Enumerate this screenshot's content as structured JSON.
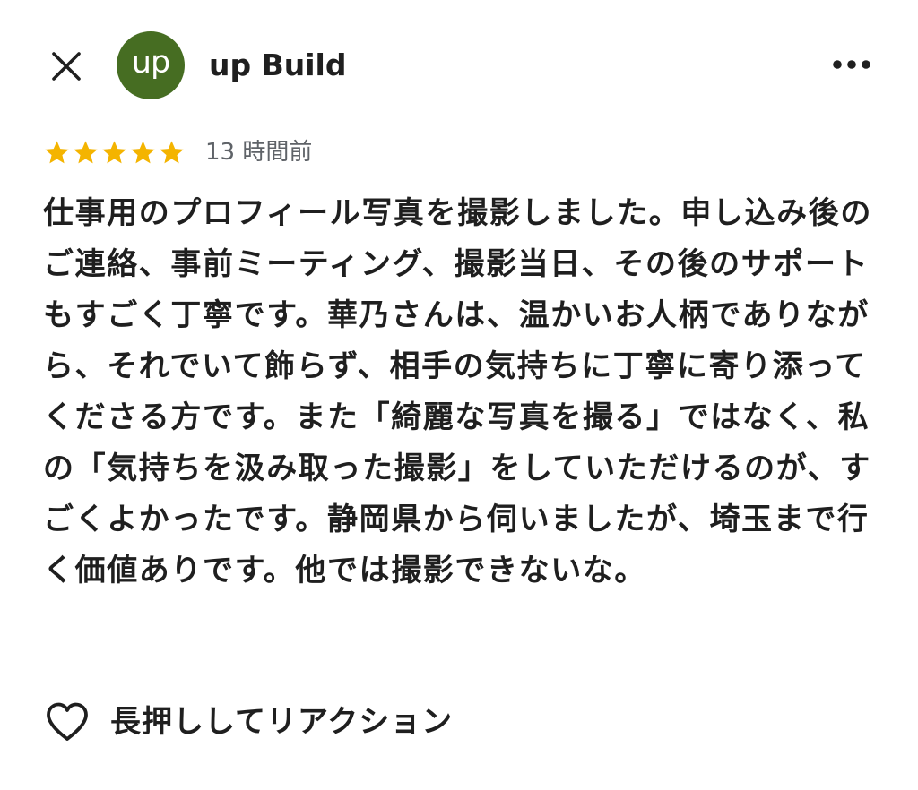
{
  "header": {
    "avatar_text": "up",
    "business_name": "up Build",
    "close_icon": "close-icon",
    "more_icon": "more-horizontal-icon"
  },
  "review": {
    "rating": 5,
    "rating_max": 5,
    "time_ago": "13 時間前",
    "text": "仕事用のプロフィール写真を撮影しました。申し込み後のご連絡、事前ミーティング、撮影当日、その後のサポートもすごく丁寧です。華乃さんは、温かいお人柄でありながら、それでいて飾らず、相手の気持ちに丁寧に寄り添ってくださる方です。また「綺麗な写真を撮る」ではなく、私の「気持ちを汲み取った撮影」をしていただけるのが、すごくよかったです。静岡県から伺いましたが、埼玉まで行く価値ありです。他では撮影できないな。"
  },
  "reaction": {
    "icon": "heart-outline-icon",
    "label": "長押ししてリアクション"
  },
  "colors": {
    "star": "#f4b400",
    "avatar_bg": "#466d22",
    "text": "#1f1f1f",
    "muted_text": "#5f6368",
    "background": "#ffffff"
  }
}
